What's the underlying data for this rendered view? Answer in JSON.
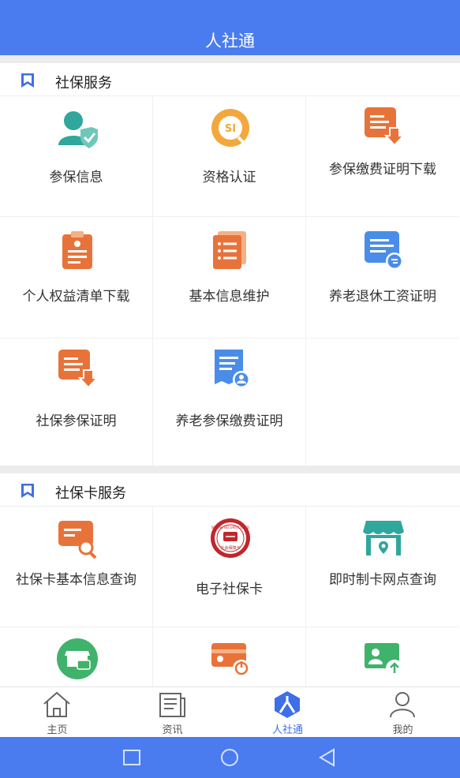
{
  "header": {
    "title": "人社通"
  },
  "sections": [
    {
      "title": "社保服务",
      "items": [
        {
          "label": "参保信息",
          "icon": "person-shield-icon"
        },
        {
          "label": "资格认证",
          "icon": "si-search-icon"
        },
        {
          "label": "参保缴费证明下载",
          "icon": "document-download-icon"
        },
        {
          "label": "个人权益清单下载",
          "icon": "clipboard-list-icon"
        },
        {
          "label": "基本信息维护",
          "icon": "list-document-icon"
        },
        {
          "label": "养老退休工资证明",
          "icon": "pension-certificate-icon"
        },
        {
          "label": "社保参保证明",
          "icon": "document-download-icon"
        },
        {
          "label": "养老参保缴费证明",
          "icon": "person-document-icon"
        }
      ]
    },
    {
      "title": "社保卡服务",
      "items": [
        {
          "label": "社保卡基本信息查询",
          "icon": "card-search-icon"
        },
        {
          "label": "电子社保卡",
          "icon": "social-security-card-icon"
        },
        {
          "label": "即时制卡网点查询",
          "icon": "store-location-icon"
        },
        {
          "label": "",
          "icon": "store-card-icon"
        },
        {
          "label": "",
          "icon": "card-power-icon"
        },
        {
          "label": "",
          "icon": "person-card-upload-icon"
        }
      ]
    }
  ],
  "tabbar": [
    {
      "label": "主页",
      "icon": "home-icon"
    },
    {
      "label": "资讯",
      "icon": "news-icon"
    },
    {
      "label": "人社通",
      "icon": "renshetong-icon",
      "active": true
    },
    {
      "label": "我的",
      "icon": "user-icon"
    }
  ],
  "badge_text": {
    "si": "SI",
    "card_top": "SOCIAL SECURITY CARD",
    "card_bottom": "社会保障卡"
  },
  "colors": {
    "primary": "#4a7cf0",
    "orange": "#e8733a",
    "teal": "#2fa79c",
    "blue_icon": "#4a8de8",
    "green": "#3fb36b"
  }
}
